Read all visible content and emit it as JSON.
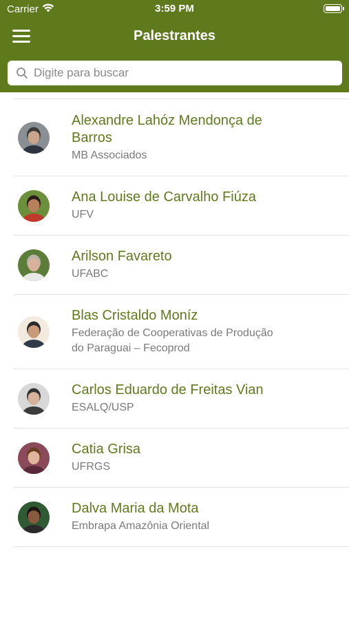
{
  "status_bar": {
    "carrier": "Carrier",
    "time": "3:59 PM"
  },
  "nav": {
    "title": "Palestrantes"
  },
  "search": {
    "placeholder": "Digite para buscar"
  },
  "speakers": [
    {
      "name": "Alexandre Lahóz Mendonça de Barros",
      "org": "MB Associados",
      "skin": "#c9a58c",
      "hair": "#3a3a3a",
      "bg": "#8a8f94",
      "shirt": "#2e3440"
    },
    {
      "name": "Ana Louise de Carvalho Fiúza",
      "org": "UFV",
      "skin": "#b87f5c",
      "hair": "#2a1d16",
      "bg": "#6b8f3a",
      "shirt": "#c0392b"
    },
    {
      "name": "Arilson Favareto",
      "org": "UFABC",
      "skin": "#d7b19a",
      "hair": "#b9b3a8",
      "bg": "#5c7c3a",
      "shirt": "#e8e8e8"
    },
    {
      "name": "Blas Cristaldo Moníz",
      "org": "Federação de Cooperativas de Produção do Paraguai – Fecoprod",
      "skin": "#c99a7a",
      "hair": "#2b2b2b",
      "bg": "#f3ebe0",
      "shirt": "#2f3a4a"
    },
    {
      "name": "Carlos Eduardo de Freitas Vian",
      "org": "ESALQ/USP",
      "skin": "#d6b29b",
      "hair": "#333333",
      "bg": "#d8d8d8",
      "shirt": "#3b3b3b"
    },
    {
      "name": "Catia Grisa",
      "org": "UFRGS",
      "skin": "#e0b59b",
      "hair": "#6b3e22",
      "bg": "#8a4a5a",
      "shirt": "#5a2a3a"
    },
    {
      "name": "Dalva Maria da Mota",
      "org": "Embrapa Amazônia Oriental",
      "skin": "#8a5a3e",
      "hair": "#1d1511",
      "bg": "#2f5a34",
      "shirt": "#2a2a2a"
    }
  ]
}
